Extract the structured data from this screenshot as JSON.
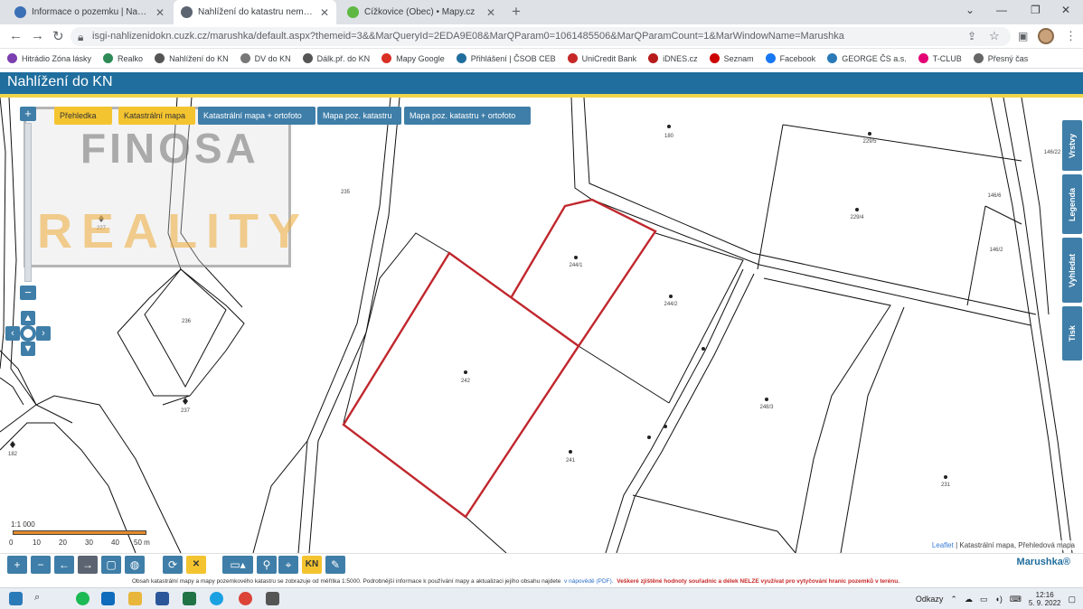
{
  "browser": {
    "tabs": [
      {
        "title": "Informace o pozemku | Nahlížení do katastru",
        "color": "#3b6fb6"
      },
      {
        "title": "Nahlížení do katastru nemovitostí p",
        "color": "#5b6470"
      },
      {
        "title": "Čížkovice (Obec) • Mapy.cz",
        "color": "#5fb843"
      }
    ],
    "new_tab": "+",
    "url": "isgi-nahlizenidokn.cuzk.cz/marushka/default.aspx?themeid=3&&MarQueryId=2EDA9E08&MarQParam0=1061485506&MarQParamCount=1&MarWindowName=Marushka",
    "bookmarks": [
      {
        "label": "Hitrádio Zóna lásky",
        "color": "#7b3fb0"
      },
      {
        "label": "Realko",
        "color": "#2e8b57"
      },
      {
        "label": "Nahlížení do KN",
        "color": "#555555"
      },
      {
        "label": "DV do KN",
        "color": "#777777"
      },
      {
        "label": "Dálk.př. do KN",
        "color": "#555555"
      },
      {
        "label": "Mapy Google",
        "color": "#d93025"
      },
      {
        "label": "Přihlášení | ČSOB CEB",
        "color": "#1f6e9e"
      },
      {
        "label": "UniCredit Bank",
        "color": "#c62828"
      },
      {
        "label": "iDNES.cz",
        "color": "#b71c1c"
      },
      {
        "label": "Seznam",
        "color": "#cc0000"
      },
      {
        "label": "Facebook",
        "color": "#1877f2"
      },
      {
        "label": "GEORGE ČS a.s.",
        "color": "#2a7ab8"
      },
      {
        "label": "T-CLUB",
        "color": "#e20074"
      },
      {
        "label": "Přesný čas",
        "color": "#666666"
      }
    ]
  },
  "app": {
    "title": "Nahlížení do KN",
    "brand": "Marushka®",
    "layers": [
      {
        "label": "Přehledka",
        "active": true
      },
      {
        "label": "Katastrální mapa",
        "active": true
      },
      {
        "label": "Katastrální mapa + ortofoto",
        "active": false
      },
      {
        "label": "Mapa poz. katastru",
        "active": false
      },
      {
        "label": "Mapa poz. katastru + ortofoto",
        "active": false
      }
    ],
    "side_tabs": [
      "Vrstvy",
      "Legenda",
      "Vyhledat",
      "Tisk"
    ],
    "scale": {
      "ratio": "1:1 000",
      "ticks": [
        "0",
        "10",
        "20",
        "30",
        "40",
        "50 m"
      ]
    },
    "attribution": {
      "link": "Leaflet",
      "text": " | Katastrální mapa, Přehledová mapa"
    },
    "footnote": {
      "main": "Obsah katastrální mapy a mapy pozemkového katastru se zobrazuje od měřítka 1:5000. Podrobnější informace k používání mapy a aktualizaci jejího obsahu najdete",
      "link": "v nápovědě (PDF).",
      "warning": "Veškeré zjištěné hodnoty souřadnic a délek NELZE využívat pro vytyčování hranic pozemků v terénu."
    },
    "kn_button": "KN"
  },
  "parcels": [
    {
      "id": "180"
    },
    {
      "id": "229/5"
    },
    {
      "id": "229/4"
    },
    {
      "id": "146/6"
    },
    {
      "id": "146/2"
    },
    {
      "id": "146/22"
    },
    {
      "id": "235"
    },
    {
      "id": "227"
    },
    {
      "id": "236"
    },
    {
      "id": "237"
    },
    {
      "id": "182"
    },
    {
      "id": "244/1"
    },
    {
      "id": "244/2"
    },
    {
      "id": "242"
    },
    {
      "id": "241"
    },
    {
      "id": "248/3"
    },
    {
      "id": "231"
    }
  ],
  "watermark": {
    "line1": "FINOSA",
    "line2": "REALITY"
  },
  "taskbar": {
    "odkazy": "Odkazy",
    "time": "12:16",
    "date": "5. 9. 2022"
  },
  "colors": {
    "header": "#1f6e9e",
    "selected_parcel": "#c0272d",
    "layer_active": "#f4c430"
  }
}
